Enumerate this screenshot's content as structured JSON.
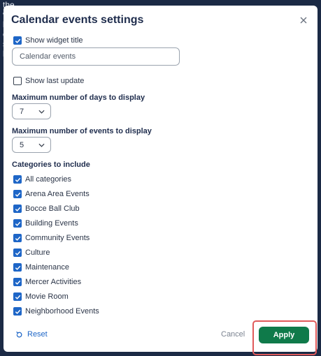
{
  "background": {
    "lines": [
      "the park",
      "v",
      "",
      "ll",
      "e",
      "s",
      "h"
    ]
  },
  "dialog": {
    "title": "Calendar events settings",
    "show_widget_title": {
      "label": "Show widget title",
      "checked": true
    },
    "widget_title_input": {
      "value": "Calendar events"
    },
    "show_last_update": {
      "label": "Show last update",
      "checked": false
    },
    "max_days": {
      "label": "Maximum number of days to display",
      "value": "7"
    },
    "max_events": {
      "label": "Maximum number of events to display",
      "value": "5"
    },
    "categories": {
      "label": "Categories to include",
      "items": [
        {
          "label": "All categories",
          "checked": true
        },
        {
          "label": "Arena Area Events",
          "checked": true
        },
        {
          "label": "Bocce Ball Club",
          "checked": true
        },
        {
          "label": "Building Events",
          "checked": true
        },
        {
          "label": "Community Events",
          "checked": true
        },
        {
          "label": "Culture",
          "checked": true
        },
        {
          "label": "Maintenance",
          "checked": true
        },
        {
          "label": "Mercer Activities",
          "checked": true
        },
        {
          "label": "Movie Room",
          "checked": true
        },
        {
          "label": "Neighborhood Events",
          "checked": true
        }
      ]
    },
    "footer": {
      "reset_label": "Reset",
      "cancel_label": "Cancel",
      "apply_label": "Apply"
    }
  },
  "colors": {
    "accent": "#1e66c7",
    "apply": "#0f7a4a",
    "highlight": "#e05a5a",
    "backdrop": "#1b2a45"
  }
}
